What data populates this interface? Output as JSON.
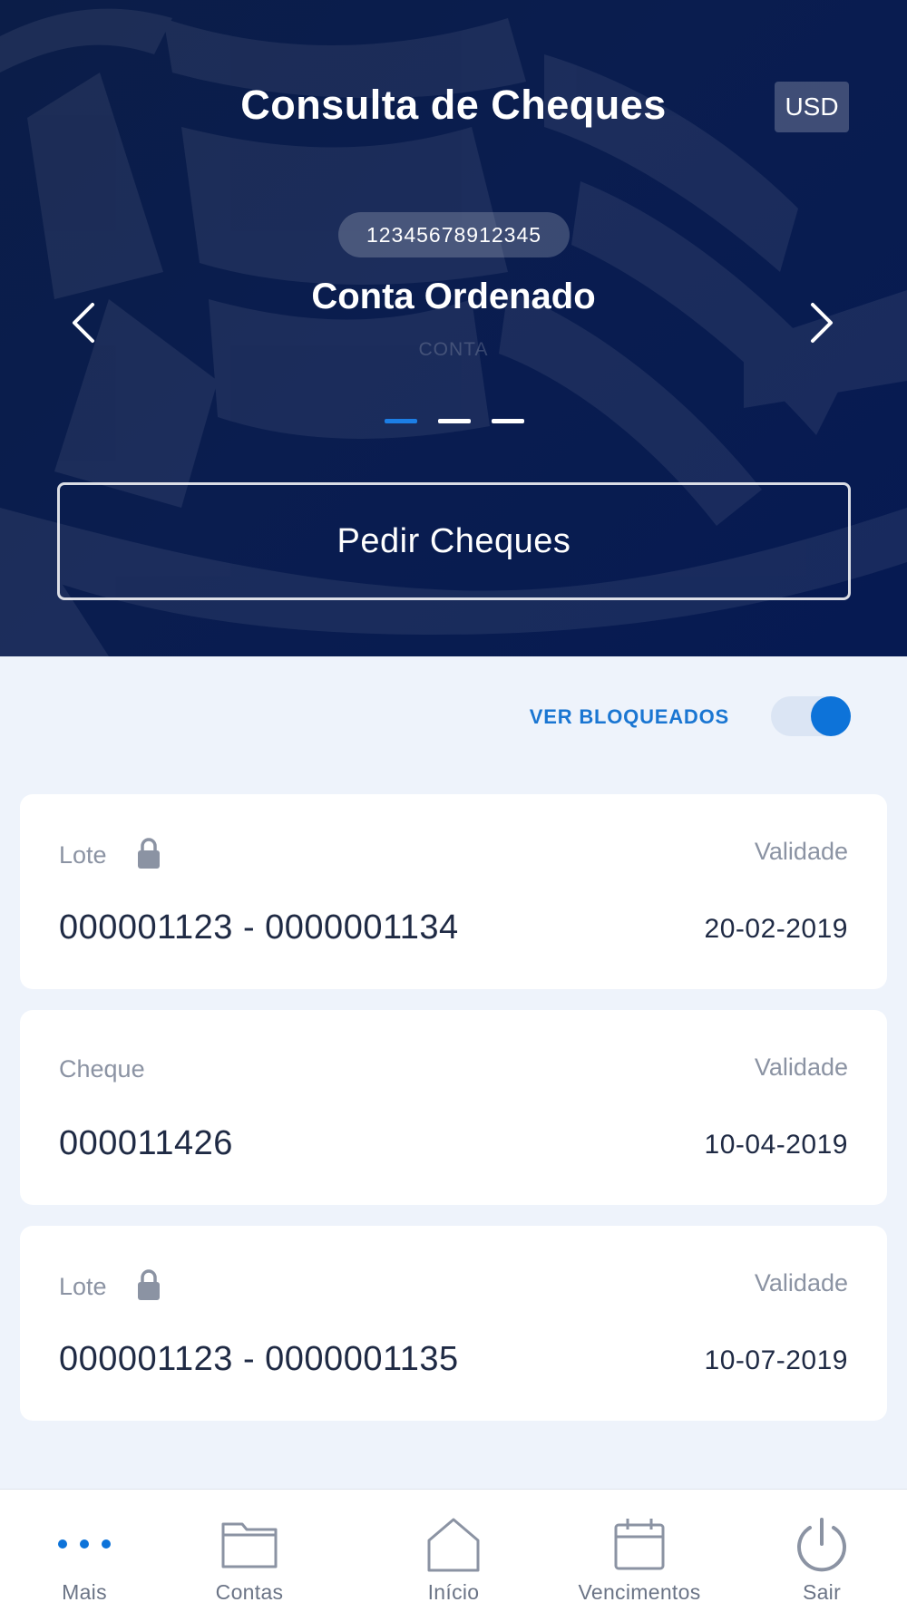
{
  "header": {
    "title": "Consulta de Cheques",
    "currency": "USD",
    "account_number": "12345678912345",
    "account_name": "Conta Ordenado",
    "account_type": "CONTA",
    "carousel_pages": 3,
    "carousel_active_index": 0,
    "order_button_label": "Pedir Cheques"
  },
  "filter": {
    "toggle_label": "VER BLOQUEADOS",
    "toggle_on": true
  },
  "items": [
    {
      "label": "Lote",
      "locked": true,
      "validity_label": "Validade",
      "number": "000001123 - 0000001134",
      "date": "20-02-2019"
    },
    {
      "label": "Cheque",
      "locked": false,
      "validity_label": "Validade",
      "number": "000011426",
      "date": "10-04-2019"
    },
    {
      "label": "Lote",
      "locked": true,
      "validity_label": "Validade",
      "number": "000001123 - 0000001135",
      "date": "10-07-2019"
    }
  ],
  "tabbar": {
    "tabs": [
      {
        "label": "Mais",
        "icon": "more-dots-icon"
      },
      {
        "label": "Contas",
        "icon": "folder-icon"
      },
      {
        "label": "Início",
        "icon": "home-icon"
      },
      {
        "label": "Vencimentos",
        "icon": "calendar-icon"
      },
      {
        "label": "Sair",
        "icon": "power-icon"
      }
    ]
  },
  "colors": {
    "hero_background": "#0a1d4f",
    "accent_blue": "#1a76d2",
    "page_background": "#eef3fb",
    "card_background": "#ffffff",
    "muted_text": "#8b93a3",
    "primary_text": "#1f2a44"
  }
}
